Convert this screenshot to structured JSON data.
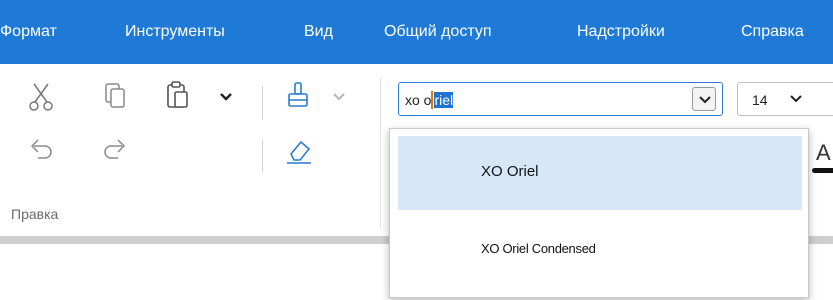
{
  "menu": {
    "items": [
      "Формат",
      "Инструменты",
      "Вид",
      "Общий доступ",
      "Надстройки",
      "Справка"
    ]
  },
  "toolbar": {
    "edit_group_label": "Правка",
    "icons": [
      "cut-icon",
      "copy-icon",
      "paste-icon",
      "paste-options-chevron-icon",
      "format-painter-icon",
      "format-painter-chevron-icon",
      "undo-icon",
      "redo-icon",
      "eraser-icon"
    ]
  },
  "font": {
    "input_before_caret": "xo o",
    "input_selected": "riel",
    "size_value": "14",
    "color_letter": "A"
  },
  "dropdown": {
    "items": [
      {
        "label": "XO Oriel",
        "selected": true
      },
      {
        "label": "XO Oriel Condensed",
        "selected": false
      }
    ]
  },
  "colors": {
    "menubar_bg": "#1e7ad6",
    "selection_bg": "#1f74d3",
    "dropdown_selected_bg": "#d6e8f7"
  }
}
